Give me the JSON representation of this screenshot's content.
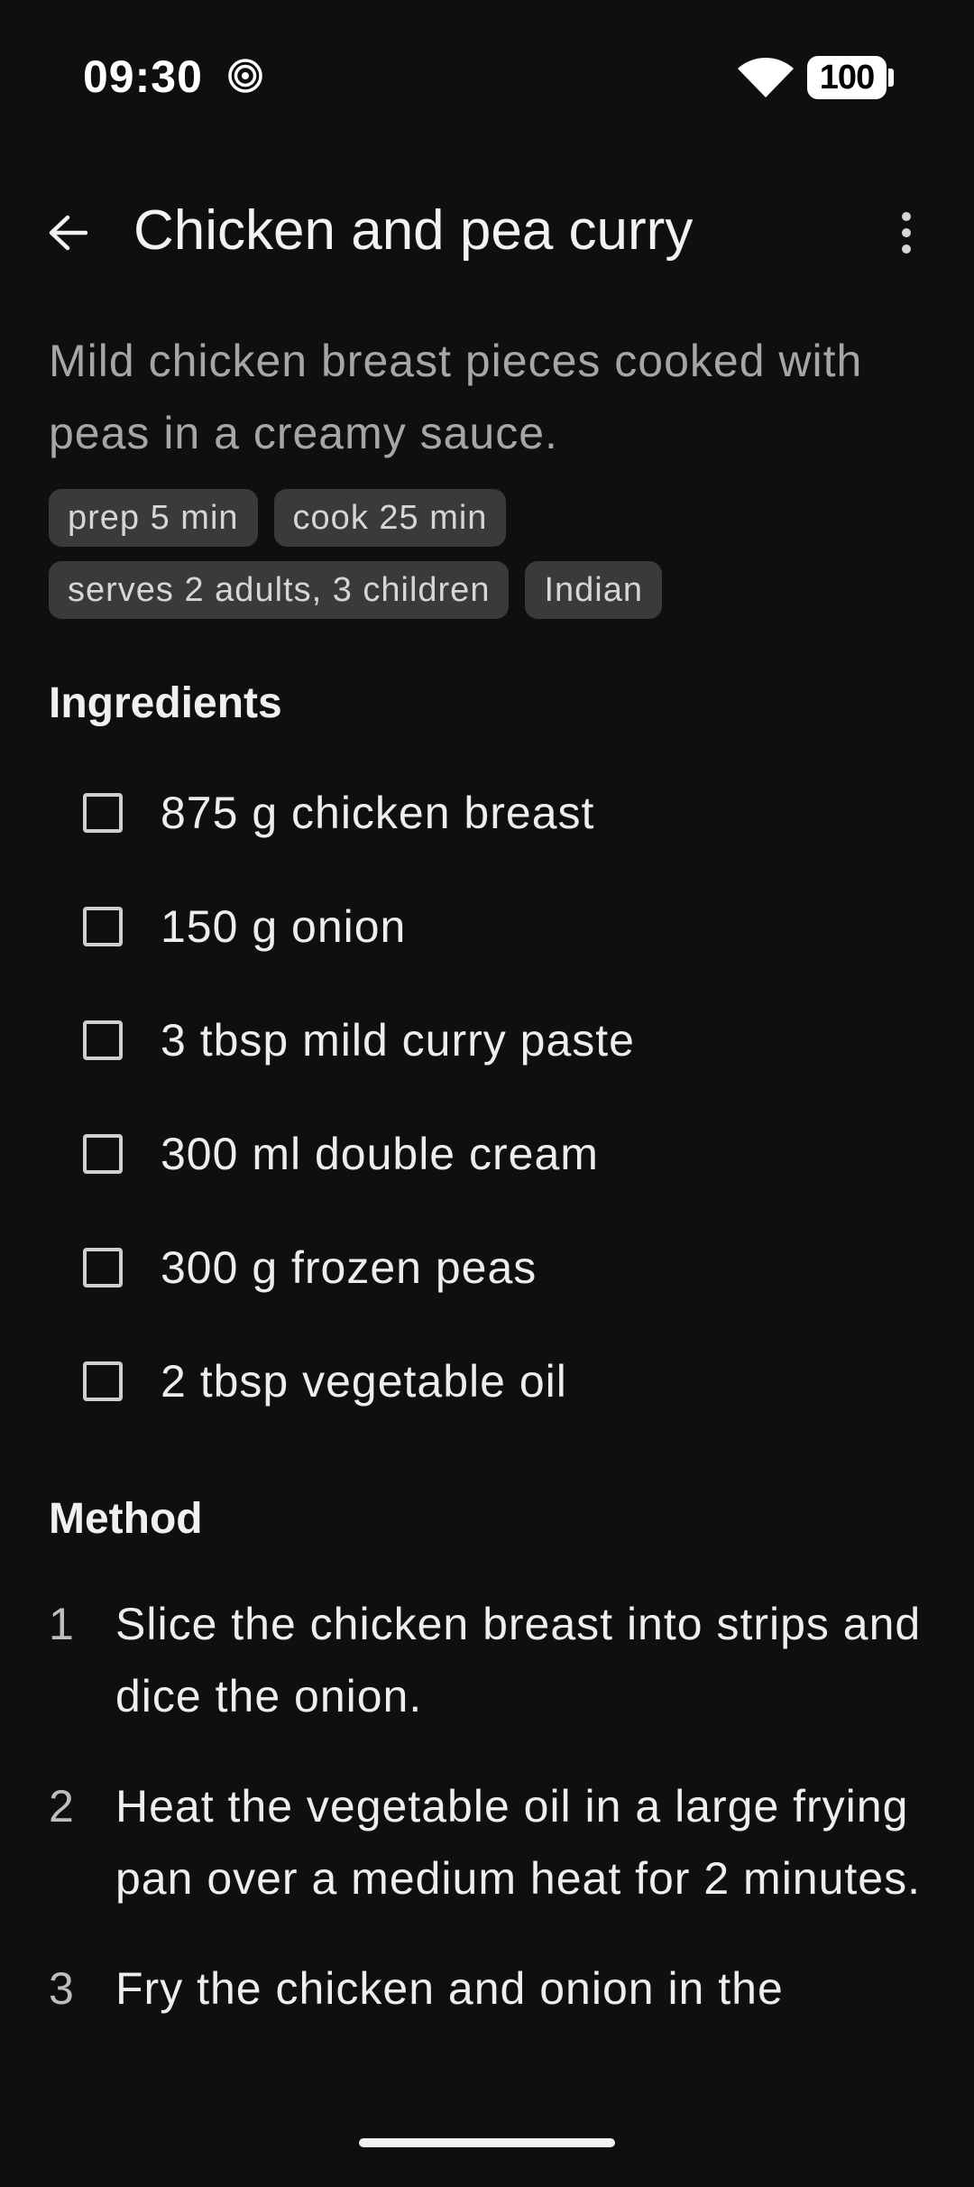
{
  "status_bar": {
    "time": "09:30",
    "battery": "100"
  },
  "app_bar": {
    "title": "Chicken and pea curry"
  },
  "recipe": {
    "description": "Mild chicken breast pieces cooked with peas in a creamy sauce.",
    "chips": {
      "prep": "prep 5 min",
      "cook": "cook 25 min",
      "serves": "serves 2 adults, 3 children",
      "cuisine": "Indian"
    }
  },
  "ingredients": {
    "heading": "Ingredients",
    "items": [
      "875 g chicken breast",
      "150 g onion",
      "3 tbsp mild curry paste",
      "300 ml double cream",
      "300 g frozen peas",
      "2 tbsp vegetable oil"
    ]
  },
  "method": {
    "heading": "Method",
    "steps": [
      {
        "number": "1",
        "text": "Slice the chicken breast into strips and dice the onion."
      },
      {
        "number": "2",
        "text": "Heat the vegetable oil in a large frying pan over a medium heat for 2 minutes."
      },
      {
        "number": "3",
        "text": "Fry the chicken and onion in the"
      }
    ]
  },
  "icons": {
    "back": "arrow-back-icon",
    "more": "more-vert-icon",
    "wifi": "wifi-icon",
    "spiral": "spiral-notification-icon"
  },
  "colors": {
    "background": "#0f0f0f",
    "chip": "#3a3a3c",
    "secondary_text": "#a6a6a6"
  }
}
